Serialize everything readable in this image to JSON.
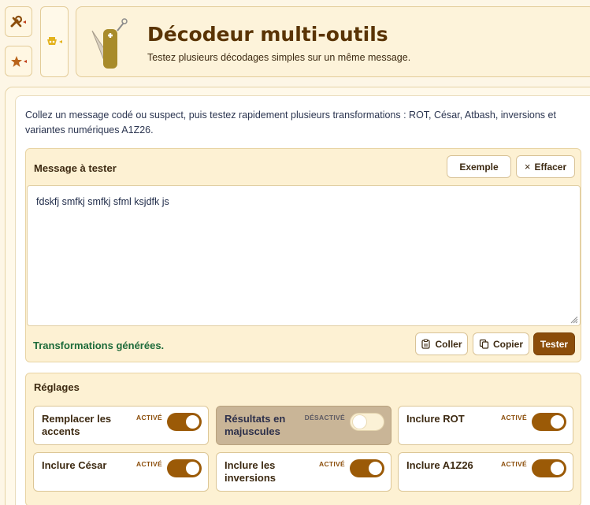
{
  "rail": {
    "tools_icon": "tools-icon",
    "favorites_icon": "star-icon",
    "subtab_icon": "decoder-icon"
  },
  "header": {
    "title": "Décodeur multi-outils",
    "subtitle": "Testez plusieurs décodages simples sur un même message.",
    "icon": "multitool-knife-icon"
  },
  "intro": "Collez un message codé ou suspect, puis testez rapidement plusieurs transformations : ROT, César, Atbash, inversions et variantes numériques A1Z26.",
  "message": {
    "title": "Message à tester",
    "example_label": "Exemple",
    "clear_label": "Effacer",
    "input_value": "fdskfj smfkj smfkj sfml ksjdfk js",
    "status": "Transformations générées.",
    "paste_label": "Coller",
    "copy_label": "Copier",
    "test_label": "Tester"
  },
  "settings": {
    "title": "Réglages",
    "options": [
      {
        "label": "Remplacer les accents",
        "state": "ACTIVÉ",
        "enabled": true
      },
      {
        "label": "Résultats en majuscules",
        "state": "DÉSACTIVÉ",
        "enabled": false
      },
      {
        "label": "Inclure ROT",
        "state": "ACTIVÉ",
        "enabled": true
      },
      {
        "label": "Inclure César",
        "state": "ACTIVÉ",
        "enabled": true
      },
      {
        "label": "Inclure les inversions",
        "state": "ACTIVÉ",
        "enabled": true
      },
      {
        "label": "Inclure A1Z26",
        "state": "ACTIVÉ",
        "enabled": true
      }
    ]
  },
  "colors": {
    "accent": "#8b4d0a",
    "toggle_on": "#9b5a07",
    "success": "#1d6b3a",
    "panel_bg": "#fdf1d3"
  }
}
